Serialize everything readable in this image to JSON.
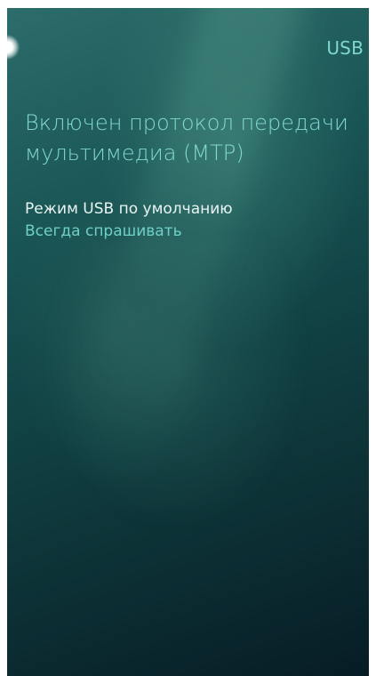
{
  "header": {
    "title": "USB"
  },
  "status": {
    "text": "Включен протокол передачи мультимедиа (MTP)"
  },
  "usb_mode": {
    "label": "Режим USB по умолчанию",
    "value": "Всегда спрашивать"
  },
  "colors": {
    "highlight": "#7fd8cc",
    "primary_text": "#e9f4f2",
    "background_top": "#2c6c6a",
    "background_bottom": "#071c25"
  },
  "icons": {
    "pulley_menu": "pulley-glow-icon"
  }
}
